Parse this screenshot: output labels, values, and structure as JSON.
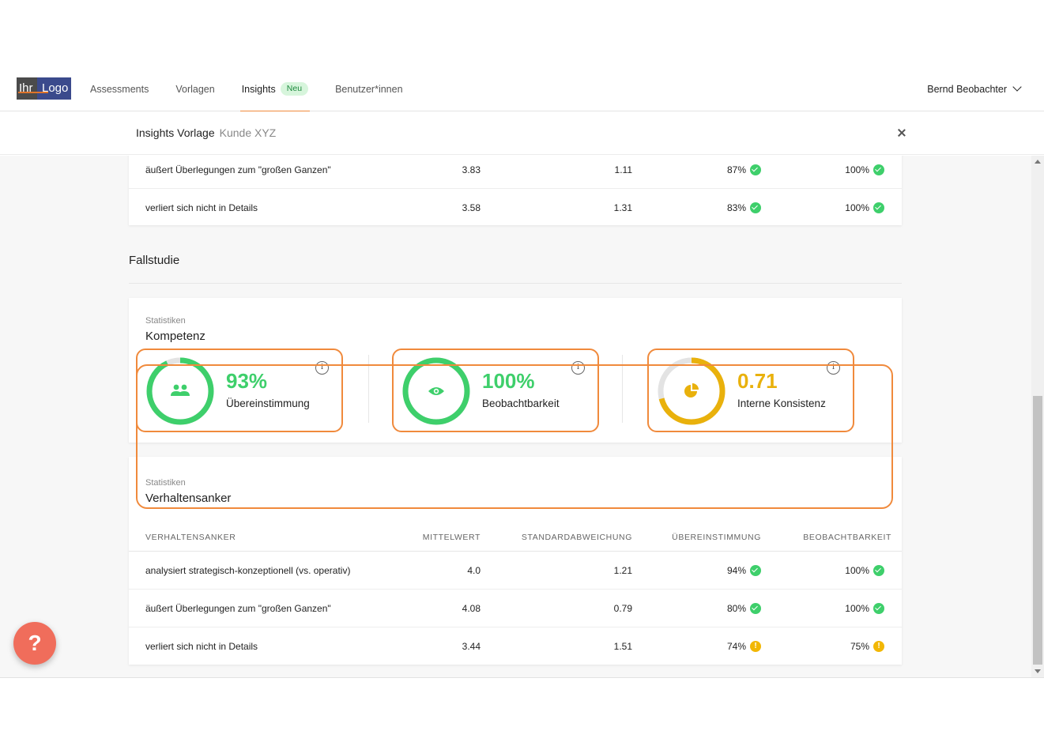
{
  "header": {
    "logo_part1": "Ihr",
    "logo_part2": "Logo",
    "nav": [
      {
        "label": "Assessments"
      },
      {
        "label": "Vorlagen"
      },
      {
        "label": "Insights",
        "badge": "Neu",
        "active": true
      },
      {
        "label": "Benutzer*innen"
      }
    ],
    "user_name": "Bernd Beobachter"
  },
  "subheader": {
    "title": "Insights Vorlage",
    "subtitle": "Kunde XYZ"
  },
  "top_table": {
    "rows": [
      {
        "name": "äußert Überlegungen zum \"großen Ganzen\"",
        "mittelwert": "3.83",
        "std": "1.11",
        "uebereinstimmung": "87%",
        "ue_status": "ok",
        "beobachtbarkeit": "100%",
        "be_status": "ok"
      },
      {
        "name": "verliert sich nicht in Details",
        "mittelwert": "3.58",
        "std": "1.31",
        "uebereinstimmung": "83%",
        "ue_status": "ok",
        "beobachtbarkeit": "100%",
        "be_status": "ok"
      }
    ]
  },
  "section": {
    "title": "Fallstudie"
  },
  "kompetenz_card": {
    "label": "Statistiken",
    "heading": "Kompetenz",
    "kpis": [
      {
        "value": "93%",
        "label": "Übereinstimmung",
        "fraction": 0.93,
        "color": "#3ecf6b",
        "icon": "users-icon"
      },
      {
        "value": "100%",
        "label": "Beobachtbarkeit",
        "fraction": 1.0,
        "color": "#3ecf6b",
        "icon": "eye-icon"
      },
      {
        "value": "0.71",
        "label": "Interne Konsistenz",
        "fraction": 0.71,
        "color": "#e9b10c",
        "icon": "pie-chart-icon"
      }
    ],
    "info_glyph": "i"
  },
  "verhalten_card": {
    "label": "Statistiken",
    "heading": "Verhaltensanker",
    "columns": [
      "VERHALTENSANKER",
      "MITTELWERT",
      "STANDARDABWEICHUNG",
      "ÜBEREINSTIMMUNG",
      "BEOBACHTBARKEIT"
    ],
    "rows": [
      {
        "name": "analysiert strategisch-konzeptionell (vs. operativ)",
        "mittelwert": "4.0",
        "std": "1.21",
        "uebereinstimmung": "94%",
        "ue_status": "ok",
        "beobachtbarkeit": "100%",
        "be_status": "ok"
      },
      {
        "name": "äußert Überlegungen zum \"großen Ganzen\"",
        "mittelwert": "4.08",
        "std": "0.79",
        "uebereinstimmung": "80%",
        "ue_status": "ok",
        "beobachtbarkeit": "100%",
        "be_status": "ok"
      },
      {
        "name": "verliert sich nicht in Details",
        "mittelwert": "3.44",
        "std": "1.51",
        "uebereinstimmung": "74%",
        "ue_status": "warn",
        "beobachtbarkeit": "75%",
        "be_status": "warn"
      }
    ]
  },
  "help_button": {
    "label": "?"
  },
  "colors": {
    "accent": "#f08a3c",
    "success": "#3ecf6b",
    "warning": "#e9b10c",
    "help": "#f06d5b"
  }
}
